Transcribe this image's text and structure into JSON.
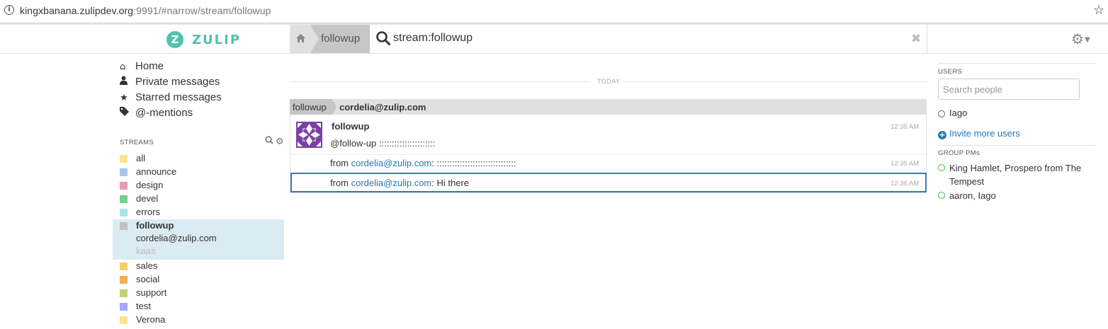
{
  "browser": {
    "url_host": "kingxbanana.zulipdev.org",
    "url_rest": ":9991/#narrow/stream/followup",
    "info_icon": "info-icon",
    "bookmark_icon": "star-icon"
  },
  "brand": {
    "logo_letter": "Z",
    "name": "ZULIP",
    "color": "#52c2af"
  },
  "topnav": {
    "home_icon": "home-icon",
    "stream_crumb": "followup",
    "search_query": "stream:followup",
    "clear_icon": "close-icon",
    "settings_icon": "gear-icon"
  },
  "leftnav": {
    "items": [
      {
        "icon": "home-icon",
        "label": "Home"
      },
      {
        "icon": "user-icon",
        "label": "Private messages"
      },
      {
        "icon": "star-icon",
        "label": "Starred messages"
      },
      {
        "icon": "tag-icon",
        "label": "@-mentions"
      }
    ],
    "streams_header": "STREAMS",
    "streams": [
      {
        "name": "all",
        "color": "#fbe491"
      },
      {
        "name": "announce",
        "color": "#a6c7e5"
      },
      {
        "name": "design",
        "color": "#e79ab5"
      },
      {
        "name": "devel",
        "color": "#76ce90"
      },
      {
        "name": "errors",
        "color": "#ace5e5"
      },
      {
        "name": "followup",
        "color": "#c2c2c2"
      },
      {
        "name": "sales",
        "color": "#f5ce6e"
      },
      {
        "name": "social",
        "color": "#f4ae55"
      },
      {
        "name": "support",
        "color": "#bfd56f"
      },
      {
        "name": "test",
        "color": "#a6a6fb"
      },
      {
        "name": "Verona",
        "color": "#fbe491"
      }
    ],
    "active_topics": [
      "cordelia@zulip.com",
      "kaas"
    ]
  },
  "messages": {
    "date_divider": "TODAY",
    "recipient": {
      "stream": "followup",
      "topic": "cordelia@zulip.com"
    },
    "sender": "followup",
    "items": [
      {
        "prefix": "",
        "link": "",
        "text": "@follow-up ::::::::::::::::::::::",
        "time": "12:35 AM"
      },
      {
        "prefix": "from ",
        "link": "cordelia@zulip.com",
        "text": ": :::::::::::::::::::::::::::::::",
        "time": "12:35 AM"
      },
      {
        "prefix": "from ",
        "link": "cordelia@zulip.com",
        "text": ": Hi there",
        "time": "12:36 AM"
      }
    ]
  },
  "rightbar": {
    "users_header": "USERS",
    "search_placeholder": "Search people",
    "users": [
      {
        "name": "Iago",
        "status": "offline"
      }
    ],
    "invite_label": "Invite more users",
    "group_pms_header": "GROUP PMs",
    "group_pms": [
      {
        "name": "King Hamlet, Prospero from The Tempest"
      },
      {
        "name": "aaron, Iago"
      }
    ],
    "colors": {
      "link": "#2478b6",
      "active_dot": "#44bb44",
      "offline_dot": "#666666"
    }
  }
}
